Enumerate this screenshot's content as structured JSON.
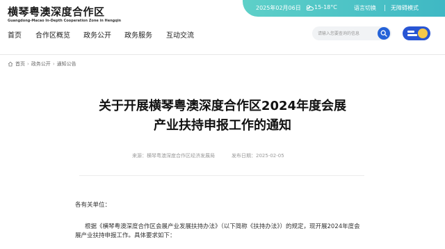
{
  "site": {
    "name_cn": "横琴粤澳深度合作区",
    "name_en": "Guangdong-Macao In-Depth Cooperation Zone in Hengqin"
  },
  "topbar": {
    "date": "2025年02月06日",
    "weather": "15-18°C",
    "language": "语言切换",
    "accessibility": "无障碍模式"
  },
  "nav": {
    "items": [
      {
        "label": "首页"
      },
      {
        "label": "合作区概览"
      },
      {
        "label": "政务公开"
      },
      {
        "label": "政务服务"
      },
      {
        "label": "互动交流"
      }
    ]
  },
  "search": {
    "placeholder": "请输入您要查询的信息"
  },
  "breadcrumb": {
    "items": [
      "首页",
      "政务公开",
      "通知公告"
    ]
  },
  "article": {
    "title_line1": "关于开展横琴粤澳深度合作区2024年度会展",
    "title_line2": "产业扶持申报工作的通知",
    "source": "来源：横琴粤澳深度合作区经济发展局",
    "published": "发布日期：2025-02-05",
    "salutation": "各有关单位：",
    "body_line1": "根据《横琴粤澳深度合作区会展产业发展扶持办法》（以下简称《扶持办法》）的规定，现开展2024年度会",
    "body_line2": "展产业扶持申报工作。具体要求如下："
  },
  "colors": {
    "topbar_start": "#5ed0c8",
    "topbar_end": "#3fb8c4",
    "search_button": "#2563d8",
    "toggle_bg": "#2855d4",
    "toggle_knob": "#f5c84a"
  }
}
